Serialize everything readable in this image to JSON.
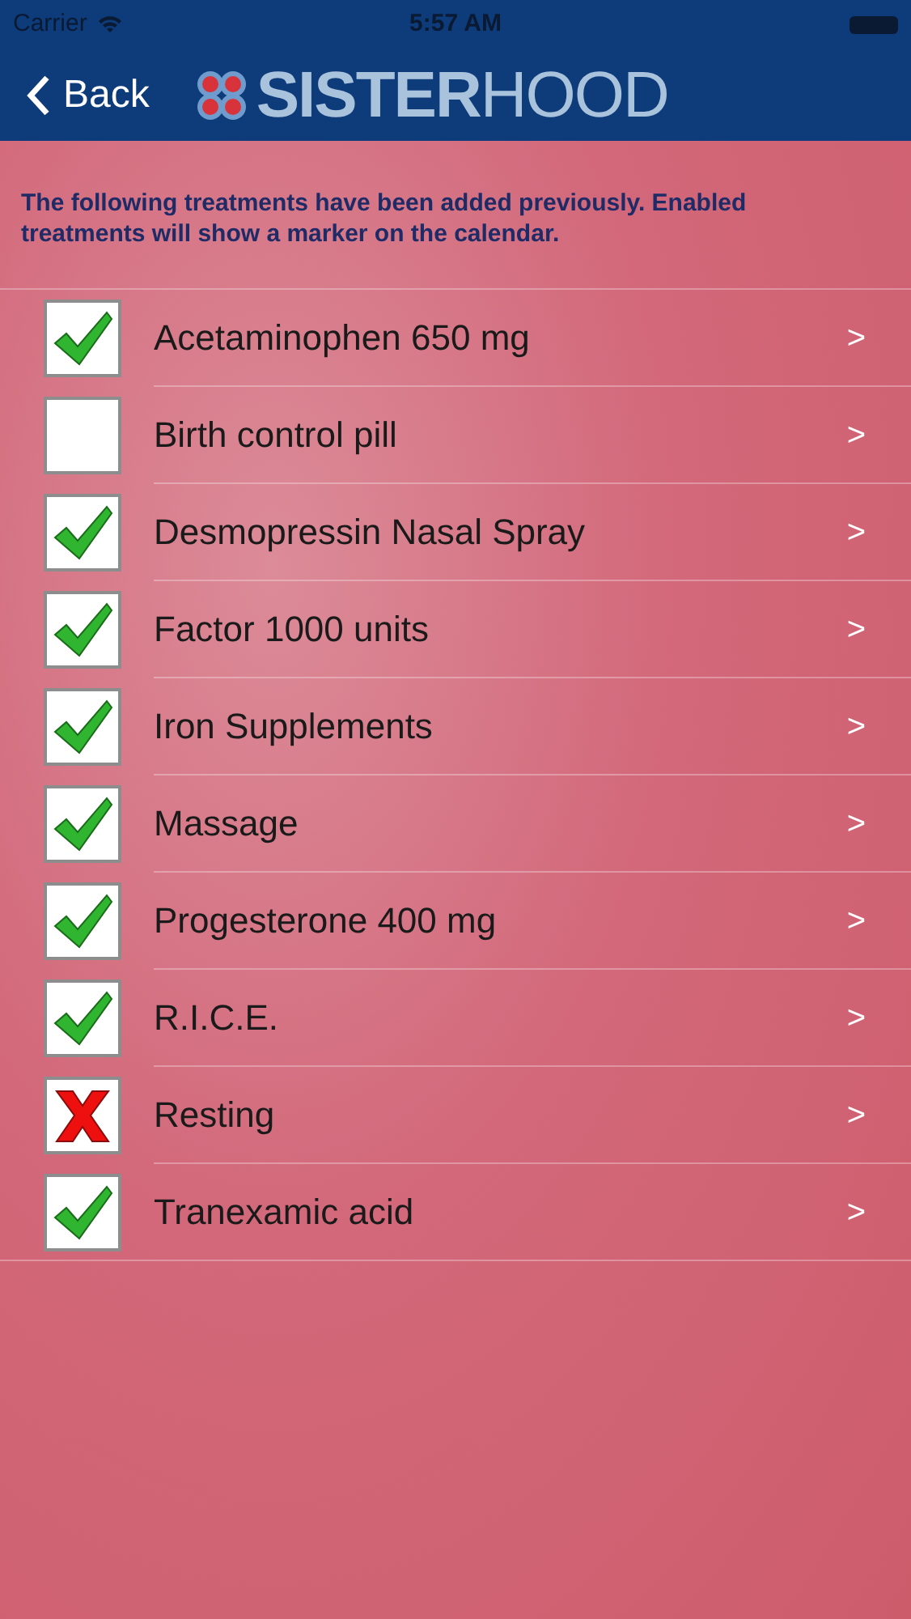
{
  "status_bar": {
    "carrier": "Carrier",
    "time": "5:57 AM"
  },
  "nav": {
    "back": "Back",
    "logo": "**SISTER**HOOD"
  },
  "intro": "The following treatments have been added previously.  Enabled treatments will show a marker on the calendar.",
  "treatments": [
    {
      "name": "Acetaminophen 650 mg",
      "checked": true,
      "kind": "tick",
      "chevron": ">"
    },
    {
      "name": "Birth control pill",
      "checked": false,
      "chevron": ">"
    },
    {
      "name": "Desmopressin Nasal Spray",
      "checked": true,
      "kind": "tick",
      "chevron": ">"
    },
    {
      "name": "Factor 1000 units",
      "checked": true,
      "kind": "tick",
      "chevron": ">"
    },
    {
      "name": "Iron Supplements",
      "checked": true,
      "kind": "tick",
      "chevron": ">"
    },
    {
      "name": "Massage",
      "checked": true,
      "kind": "tick",
      "chevron": ">"
    },
    {
      "name": "Progesterone 400 mg",
      "checked": true,
      "kind": "tick",
      "chevron": ">"
    },
    {
      "name": "R.I.C.E.",
      "checked": true,
      "kind": "tick",
      "chevron": ">"
    },
    {
      "name": "Resting",
      "checked": true,
      "kind": "cross",
      "chevron": ">"
    },
    {
      "name": "Tranexamic acid",
      "checked": true,
      "kind": "tick",
      "chevron": ">"
    }
  ]
}
